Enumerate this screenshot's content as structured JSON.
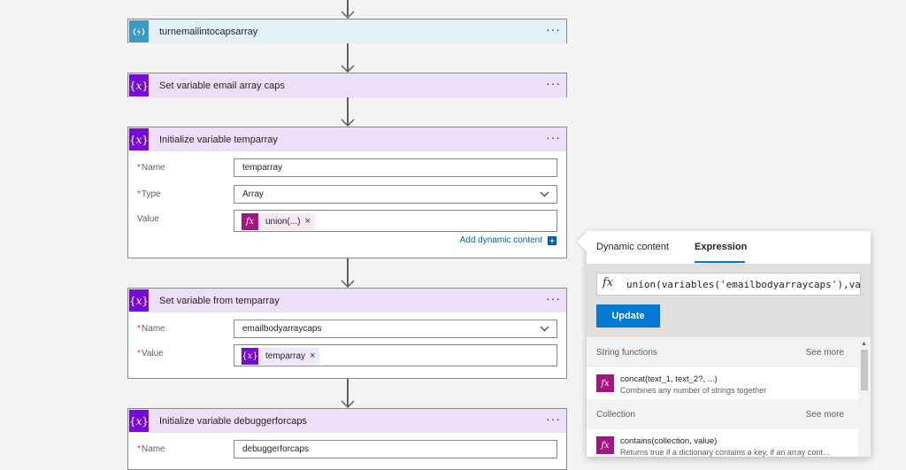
{
  "steps": [
    {
      "title": "turnemailintocapsarray",
      "type": "api"
    },
    {
      "title": "Set variable email array caps",
      "type": "var"
    },
    {
      "title": "Initialize variable temparray",
      "type": "var",
      "fields": {
        "name_label": "Name",
        "name_value": "temparray",
        "type_label": "Type",
        "type_value": "Array",
        "value_label": "Value",
        "value_token": "union(...)"
      },
      "add_dynamic": "Add dynamic content"
    },
    {
      "title": "Set variable from temparray",
      "type": "var",
      "fields": {
        "name_label": "Name",
        "name_value": "emailbodyarraycaps",
        "value_label": "Value",
        "value_token": "temparray"
      }
    },
    {
      "title": "Initialize variable debuggerforcaps",
      "type": "var",
      "fields": {
        "name_label": "Name",
        "name_value": "debuggerforcaps"
      }
    }
  ],
  "more_glyph": "···",
  "required_mark": "*",
  "token_remove": "×",
  "icons": {
    "api": "lightning-bolt-icon",
    "var": "variable-icon",
    "fx": "function-icon"
  },
  "panel": {
    "tabs": [
      "Dynamic content",
      "Expression"
    ],
    "active_tab": "Expression",
    "expression": "union(variables('emailbodyarraycaps'),va",
    "update_label": "Update",
    "sections": [
      {
        "title": "String functions",
        "see_more": "See more",
        "items": [
          {
            "name": "concat(text_1, text_2?, ...)",
            "desc": "Combines any number of strings together"
          }
        ]
      },
      {
        "title": "Collection",
        "see_more": "See more",
        "items": [
          {
            "name": "contains(collection, value)",
            "desc": "Returns true if a dictionary contains a key, if an array cont..."
          }
        ]
      }
    ]
  },
  "colors": {
    "accent": "#0078d4",
    "variable": "#770bd6",
    "api": "#3999c6",
    "function": "#a4157f"
  }
}
